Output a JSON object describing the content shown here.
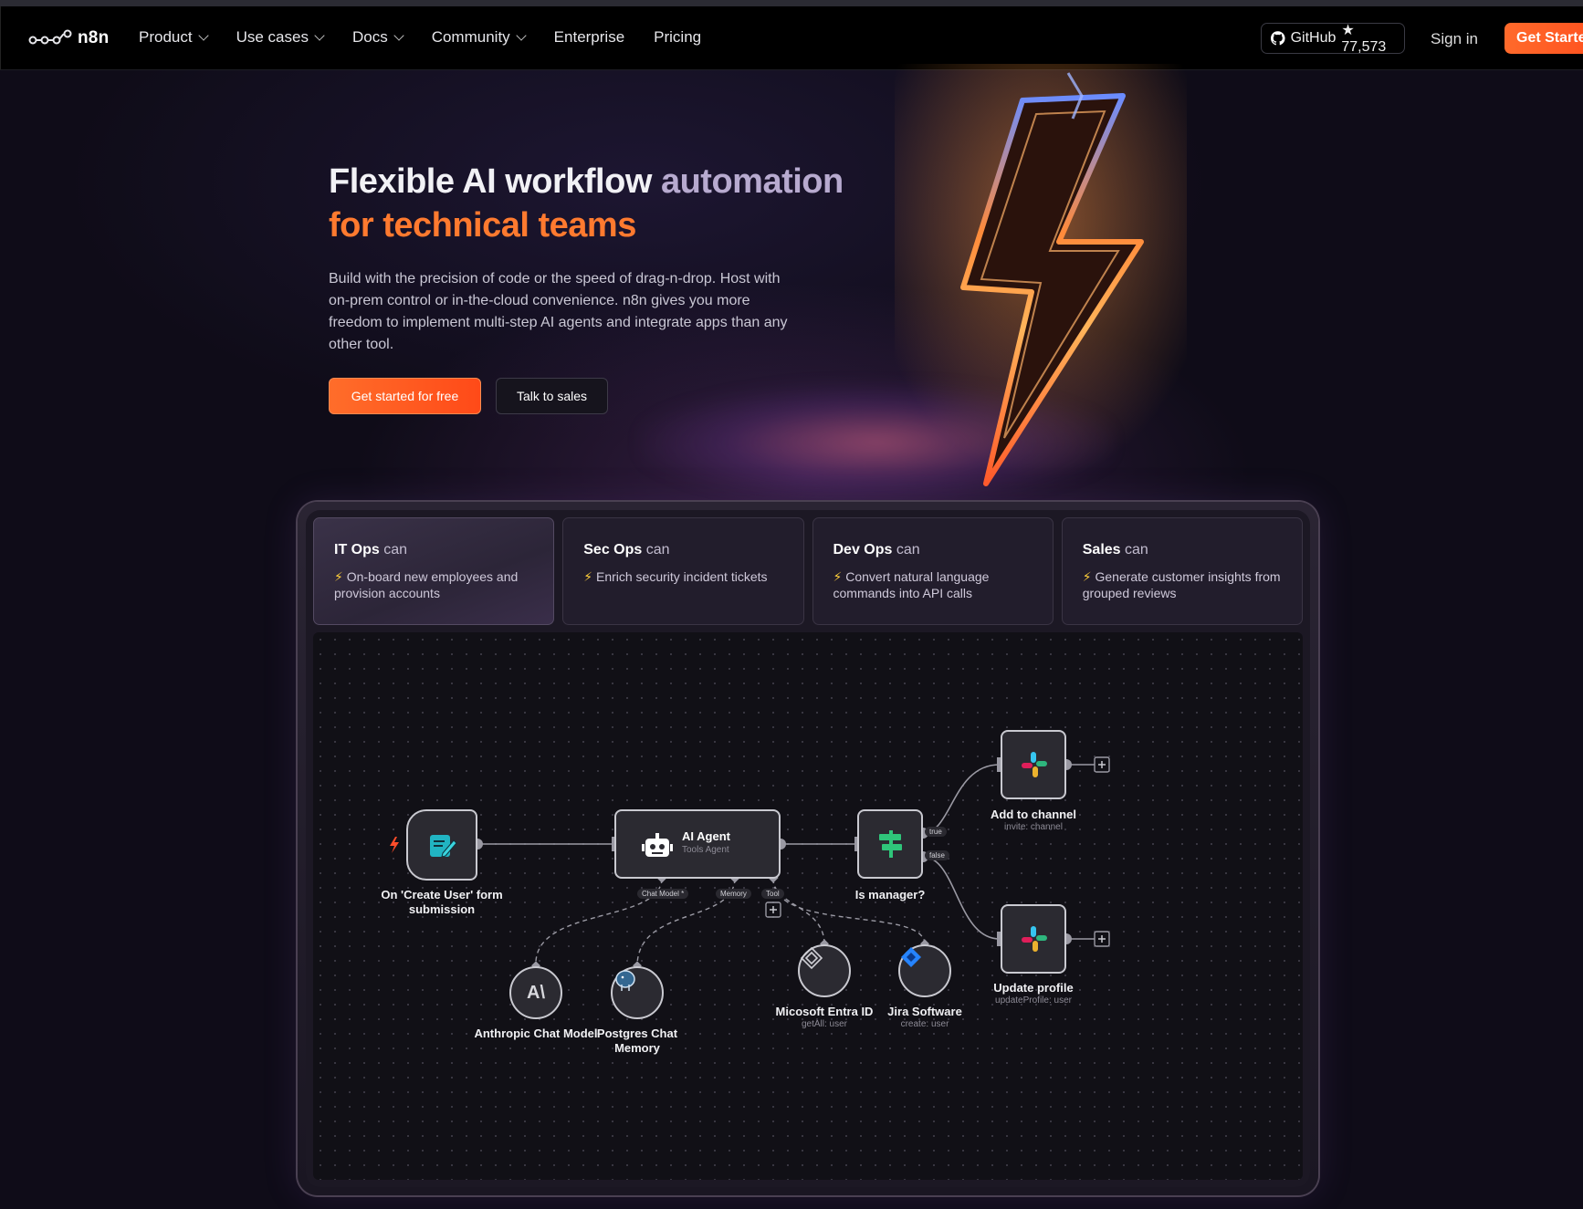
{
  "nav": {
    "logo_text": "n8n",
    "links": [
      {
        "label": "Product",
        "has_dropdown": true
      },
      {
        "label": "Use cases",
        "has_dropdown": true
      },
      {
        "label": "Docs",
        "has_dropdown": true
      },
      {
        "label": "Community",
        "has_dropdown": true
      },
      {
        "label": "Enterprise",
        "has_dropdown": false
      },
      {
        "label": "Pricing",
        "has_dropdown": false
      }
    ],
    "github_label": "GitHub",
    "github_stars": "★ 77,573",
    "sign_in": "Sign in",
    "get_started": "Get Started"
  },
  "hero": {
    "title_part1": "Flexible AI workflow ",
    "title_part2": "automation",
    "title_line2": "for technical teams",
    "description": "Build with the precision of code or the speed of drag-n-drop. Host with on-prem control or in-the-cloud convenience. n8n gives you more freedom to implement multi-step AI agents and integrate apps than any other tool.",
    "cta_primary": "Get started for free",
    "cta_secondary": "Talk to sales"
  },
  "tabs": [
    {
      "team": "IT Ops",
      "can": "can",
      "desc": "On-board new employees and provision accounts",
      "active": true
    },
    {
      "team": "Sec Ops",
      "can": "can",
      "desc": "Enrich security incident tickets",
      "active": false
    },
    {
      "team": "Dev Ops",
      "can": "can",
      "desc": "Convert natural language commands into API calls",
      "active": false
    },
    {
      "team": "Sales",
      "can": "can",
      "desc": "Generate customer insights from grouped reviews",
      "active": false
    }
  ],
  "workflow": {
    "trigger": {
      "label": "On 'Create User' form submission"
    },
    "agent": {
      "title": "AI Agent",
      "subtitle": "Tools Agent",
      "ports": [
        "Chat Model *",
        "Memory",
        "Tool"
      ]
    },
    "condition": {
      "label": "Is manager?",
      "true_label": "true",
      "false_label": "false"
    },
    "add_channel": {
      "label": "Add to channel",
      "sub": "invite: channel"
    },
    "update_profile": {
      "label": "Update profile",
      "sub": "updateProfile: user"
    },
    "anthropic": {
      "label": "Anthropic Chat Model"
    },
    "postgres": {
      "label": "Postgres Chat Memory"
    },
    "entra": {
      "label": "Micosoft Entra ID",
      "sub": "getAll: user"
    },
    "jira": {
      "label": "Jira Software",
      "sub": "create: user"
    }
  },
  "colors": {
    "accent": "#ff6a2b",
    "title_orange": "#ff7a2f",
    "title_lilac": "#b7aacf",
    "bg": "#0f0c18"
  }
}
